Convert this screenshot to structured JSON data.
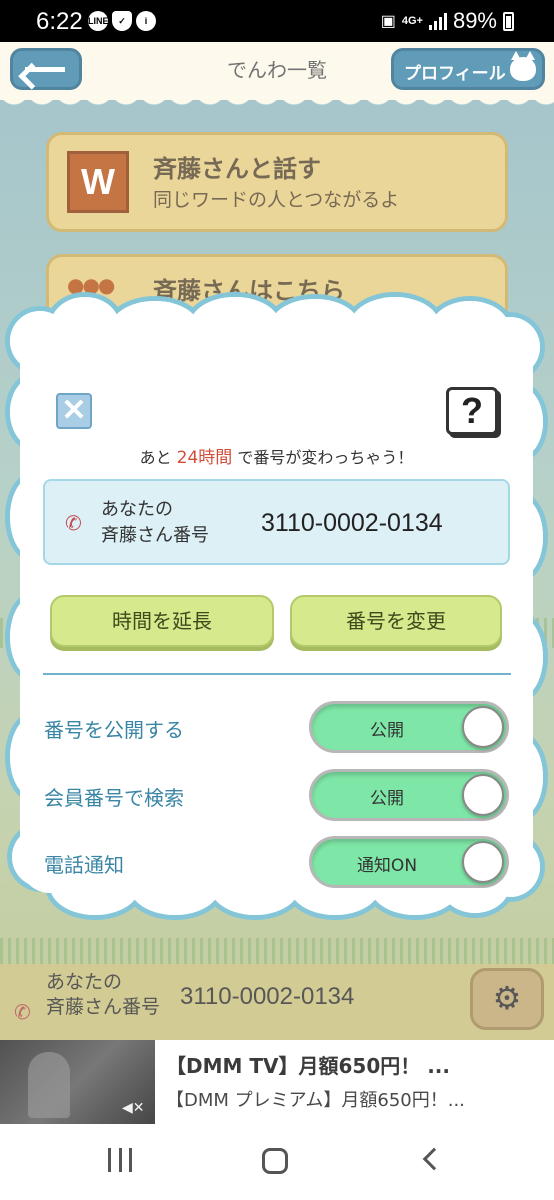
{
  "status_bar": {
    "time": "6:22",
    "left_icons": [
      "line-icon",
      "shield-check-icon",
      "info-icon"
    ],
    "network": "4G+",
    "battery": "89%"
  },
  "header": {
    "title": "でんわ一覧",
    "profile_button": "プロフィール"
  },
  "menu": [
    {
      "badge": "W",
      "title": "斉藤さんと話す",
      "subtitle": "同じワードの人とつながるよ"
    },
    {
      "title": "斉藤さんはこちら"
    }
  ],
  "modal": {
    "expire_prefix": "あと",
    "expire_highlight": "24時間",
    "expire_suffix": "で番号が変わっちゃう！",
    "number_label_line1": "あなたの",
    "number_label_line2": "斉藤さん番号",
    "number": "3110-0002-0134",
    "extend_button": "時間を延長",
    "change_button": "番号を変更",
    "settings": [
      {
        "label": "番号を公開する",
        "toggle_text": "公開",
        "on": true
      },
      {
        "label": "会員番号で検索",
        "toggle_text": "公開",
        "on": true
      },
      {
        "label": "電話通知",
        "toggle_text": "通知ON",
        "on": true
      }
    ],
    "help_glyph": "?",
    "close_glyph": "✕"
  },
  "bottom_bar": {
    "label_line1": "あなたの",
    "label_line2": "斉藤さん番号",
    "number": "3110-0002-0134"
  },
  "ad": {
    "title": "【DMM TV】月額650円！ ...",
    "subtitle": "【DMM プレミアム】月額650円！..."
  },
  "colors": {
    "accent_blue": "#3d86a9",
    "highlight_red": "#d24e3a",
    "toggle_green": "#7ee6a6",
    "button_green": "#d7e98d"
  }
}
